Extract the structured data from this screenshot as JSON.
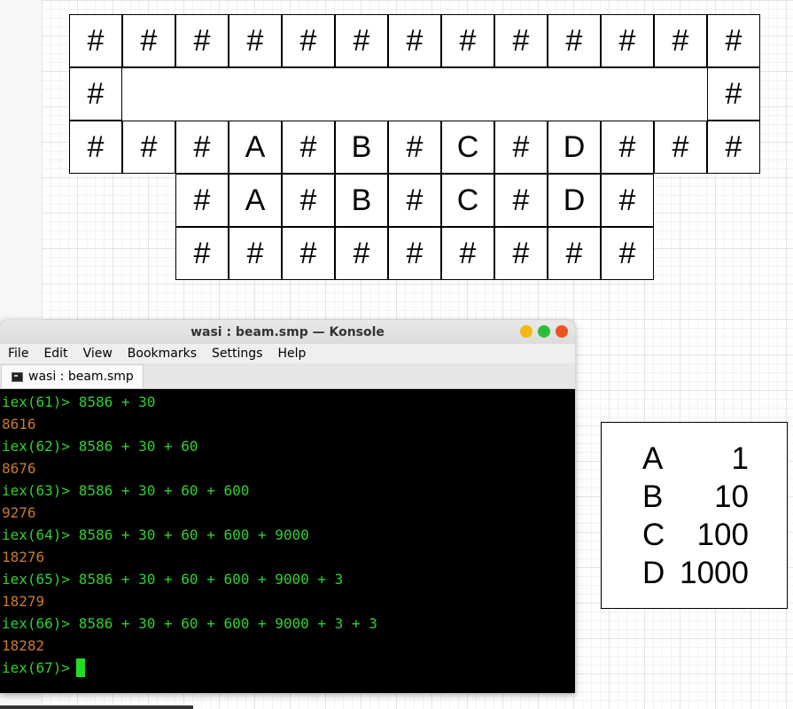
{
  "grid": {
    "row1": [
      "#",
      "#",
      "#",
      "#",
      "#",
      "#",
      "#",
      "#",
      "#",
      "#",
      "#",
      "#",
      "#"
    ],
    "row2_left": "#",
    "row2_right": "#",
    "row3": [
      "#",
      "#",
      "#",
      "A",
      "#",
      "B",
      "#",
      "C",
      "#",
      "D",
      "#",
      "#",
      "#"
    ],
    "row4": [
      "#",
      "A",
      "#",
      "B",
      "#",
      "C",
      "#",
      "D",
      "#"
    ],
    "row5": [
      "#",
      "#",
      "#",
      "#",
      "#",
      "#",
      "#",
      "#",
      "#"
    ]
  },
  "legend": [
    {
      "letter": "A",
      "value": "1"
    },
    {
      "letter": "B",
      "value": "10"
    },
    {
      "letter": "C",
      "value": "100"
    },
    {
      "letter": "D",
      "value": "1000"
    }
  ],
  "konsole": {
    "title": "wasi : beam.smp — Konsole",
    "menu": [
      "File",
      "Edit",
      "View",
      "Bookmarks",
      "Settings",
      "Help"
    ],
    "tab_label": "wasi : beam.smp",
    "lines": [
      {
        "kind": "prompt",
        "text": "iex(61)> 8586 + 30"
      },
      {
        "kind": "result",
        "text": "8616"
      },
      {
        "kind": "prompt",
        "text": "iex(62)> 8586 + 30 + 60"
      },
      {
        "kind": "result",
        "text": "8676"
      },
      {
        "kind": "prompt",
        "text": "iex(63)> 8586 + 30 + 60 + 600"
      },
      {
        "kind": "result",
        "text": "9276"
      },
      {
        "kind": "prompt",
        "text": "iex(64)> 8586 + 30 + 60 + 600 + 9000"
      },
      {
        "kind": "result",
        "text": "18276"
      },
      {
        "kind": "prompt",
        "text": "iex(65)> 8586 + 30 + 60 + 600 + 9000 + 3"
      },
      {
        "kind": "result",
        "text": "18279"
      },
      {
        "kind": "prompt",
        "text": "iex(66)> 8586 + 30 + 60 + 600 + 9000 + 3 + 3"
      },
      {
        "kind": "result",
        "text": "18282"
      }
    ],
    "current_prompt": "iex(67)>",
    "colors": {
      "prompt": "#2fd12f",
      "result": "#c97a2c",
      "close_button": "#e95420",
      "maximize_button": "#2dbd3c",
      "minimize_button": "#f5b912"
    }
  }
}
